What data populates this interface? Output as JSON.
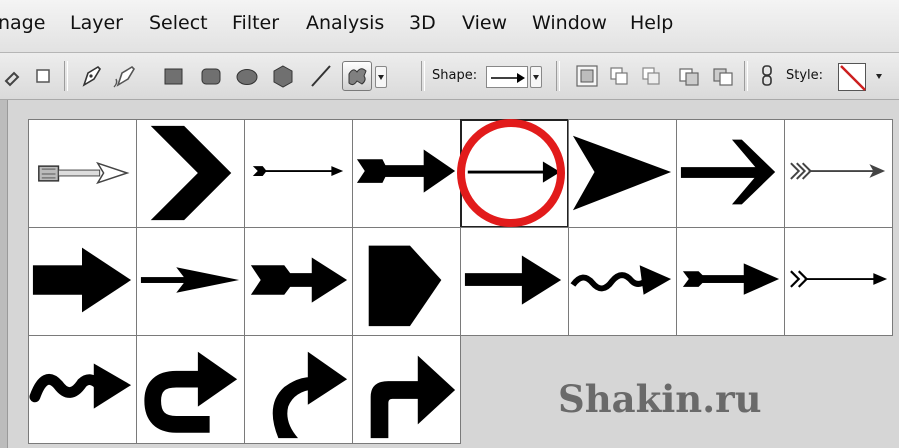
{
  "menu": [
    "nage",
    "Layer",
    "Select",
    "Filter",
    "Analysis",
    "3D",
    "View",
    "Window",
    "Help"
  ],
  "options": {
    "shape_label": "Shape:",
    "style_label": "Style:"
  },
  "toolbar_icons": [
    "freeform-lasso-icon",
    "rectangle-marquee-icon",
    "pen-icon",
    "freeform-pen-icon",
    "rectangle-shape-icon",
    "rounded-rectangle-icon",
    "ellipse-icon",
    "polygon-icon",
    "line-icon",
    "custom-shape-icon",
    "shape-layers-icon",
    "paths-icon",
    "fill-pixels-icon",
    "add-to-area-icon",
    "subtract-area-icon",
    "link-icon"
  ],
  "shape_picker": {
    "selected_index": 4,
    "shapes": [
      "arrow-feathered",
      "chevron-arrow",
      "thin-arrow-tail",
      "heavy-tail-arrow",
      "thin-arrow",
      "triangle-arrow",
      "bold-line-arrow",
      "double-feather-arrow",
      "block-arrow",
      "slim-arrow",
      "notched-arrow",
      "pentagon-arrow",
      "medium-arrow",
      "wavy-arrow",
      "notched-line-arrow",
      "feathered-thin-arrow",
      "squiggle-arrow",
      "u-turn-arrow",
      "curved-arrow",
      "right-angle-arrow"
    ]
  },
  "watermark": "Shakin.ru",
  "colors": {
    "highlight": "#e21b1b",
    "no_style": "#cc1f1f"
  }
}
